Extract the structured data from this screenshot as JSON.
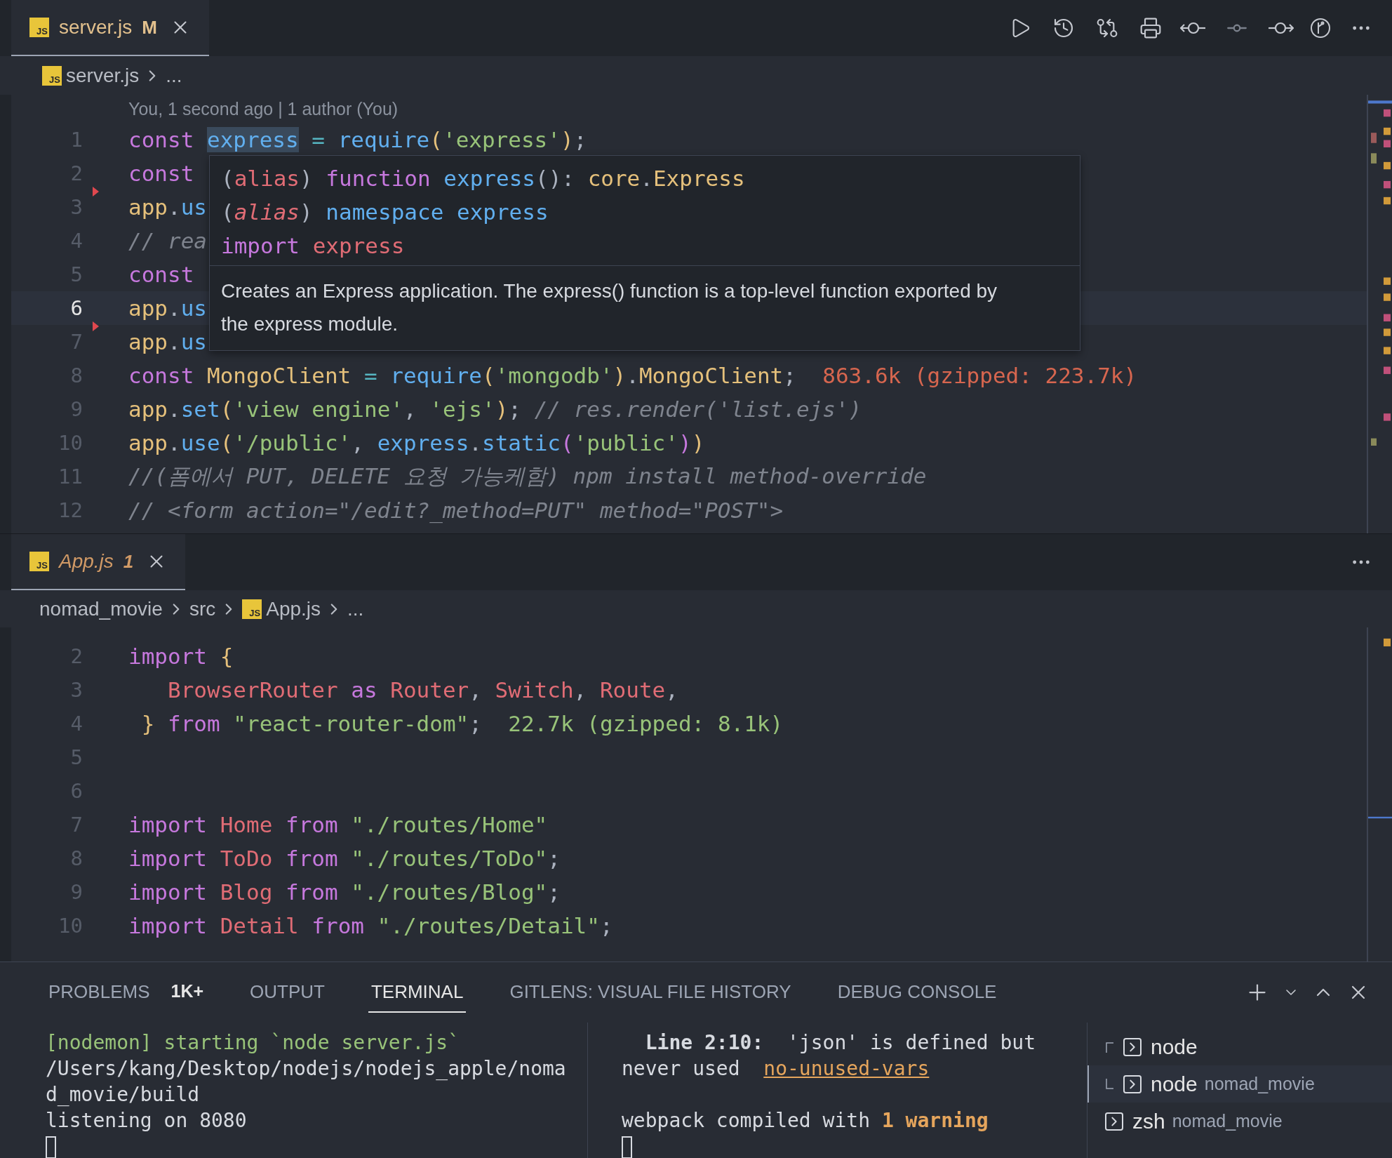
{
  "top_editor": {
    "tab": {
      "file_icon": "JS",
      "label": "server.js",
      "status": "M",
      "kind": "modified",
      "preview": false,
      "selected": true
    },
    "breadcrumbs": [
      {
        "file_icon": "JS",
        "label": "server.js"
      },
      {
        "label": "..."
      }
    ],
    "blame": "You, 1 second ago | 1 author (You)",
    "lines": [
      {
        "number": "1",
        "current": false,
        "deleted_marker": false,
        "tokens": [
          {
            "text": "const ",
            "kind": "kw"
          },
          {
            "text": "express",
            "kind": "hl"
          },
          {
            "text": " = ",
            "kind": "op"
          },
          {
            "text": "require",
            "kind": "fn"
          },
          {
            "text": "(",
            "kind": "b1"
          },
          {
            "text": "'express'",
            "kind": "str"
          },
          {
            "text": ")",
            "kind": "b1"
          },
          {
            "text": ";",
            "kind": "p"
          }
        ]
      },
      {
        "number": "2",
        "current": false,
        "deleted_marker": false,
        "tokens": [
          {
            "text": "const",
            "kind": "kw"
          }
        ]
      },
      {
        "number": "3",
        "current": false,
        "deleted_marker": true,
        "tokens": [
          {
            "text": "app",
            "kind": "cls"
          },
          {
            "text": ".",
            "kind": "p"
          },
          {
            "text": "us",
            "kind": "fn"
          }
        ]
      },
      {
        "number": "4",
        "current": false,
        "deleted_marker": false,
        "tokens": [
          {
            "text": "// rea",
            "kind": "cm"
          }
        ]
      },
      {
        "number": "5",
        "current": false,
        "deleted_marker": false,
        "tokens": [
          {
            "text": "const",
            "kind": "kw"
          }
        ]
      },
      {
        "number": "6",
        "current": true,
        "deleted_marker": false,
        "tokens": [
          {
            "text": "app",
            "kind": "cls"
          },
          {
            "text": ".",
            "kind": "p"
          },
          {
            "text": "us",
            "kind": "fn"
          }
        ]
      },
      {
        "number": "7",
        "current": false,
        "deleted_marker": true,
        "tokens": [
          {
            "text": "app",
            "kind": "cls"
          },
          {
            "text": ".",
            "kind": "p"
          },
          {
            "text": "us",
            "kind": "fn"
          }
        ]
      },
      {
        "number": "8",
        "current": false,
        "deleted_marker": false,
        "tokens": [
          {
            "text": "const ",
            "kind": "kw"
          },
          {
            "text": "MongoClient",
            "kind": "cls"
          },
          {
            "text": " = ",
            "kind": "op"
          },
          {
            "text": "require",
            "kind": "fn"
          },
          {
            "text": "(",
            "kind": "b1"
          },
          {
            "text": "'mongodb'",
            "kind": "str"
          },
          {
            "text": ")",
            "kind": "b1"
          },
          {
            "text": ".",
            "kind": "p"
          },
          {
            "text": "MongoClient",
            "kind": "cls"
          },
          {
            "text": ";",
            "kind": "p"
          },
          {
            "text": "  863.6k (gzipped: 223.7k)",
            "kind": "sizered"
          }
        ]
      },
      {
        "number": "9",
        "current": false,
        "deleted_marker": false,
        "tokens": [
          {
            "text": "app",
            "kind": "cls"
          },
          {
            "text": ".",
            "kind": "p"
          },
          {
            "text": "set",
            "kind": "fn"
          },
          {
            "text": "(",
            "kind": "b1"
          },
          {
            "text": "'view engine'",
            "kind": "str"
          },
          {
            "text": ", ",
            "kind": "p"
          },
          {
            "text": "'ejs'",
            "kind": "str"
          },
          {
            "text": ")",
            "kind": "b1"
          },
          {
            "text": ";",
            "kind": "p"
          },
          {
            "text": " // res.render('list.ejs')",
            "kind": "cm"
          }
        ]
      },
      {
        "number": "10",
        "current": false,
        "deleted_marker": false,
        "tokens": [
          {
            "text": "app",
            "kind": "cls"
          },
          {
            "text": ".",
            "kind": "p"
          },
          {
            "text": "use",
            "kind": "fn"
          },
          {
            "text": "(",
            "kind": "b1"
          },
          {
            "text": "'/public'",
            "kind": "str"
          },
          {
            "text": ", ",
            "kind": "p"
          },
          {
            "text": "express",
            "kind": "var"
          },
          {
            "text": ".",
            "kind": "p"
          },
          {
            "text": "static",
            "kind": "fn"
          },
          {
            "text": "(",
            "kind": "b2"
          },
          {
            "text": "'public'",
            "kind": "str"
          },
          {
            "text": ")",
            "kind": "b2"
          },
          {
            "text": ")",
            "kind": "b1"
          }
        ]
      },
      {
        "number": "11",
        "current": false,
        "deleted_marker": false,
        "tokens": [
          {
            "text": "//(폼에서 PUT, DELETE 요청 가능케함) npm install method-override",
            "kind": "cm"
          }
        ]
      },
      {
        "number": "12",
        "current": false,
        "deleted_marker": false,
        "tokens": [
          {
            "text": "// <form action=\"/edit?_method=PUT\" method=\"POST\">",
            "kind": "cm"
          }
        ]
      }
    ],
    "hover": {
      "signature": [
        [
          {
            "text": "(",
            "kind": "p"
          },
          {
            "text": "alias",
            "kind": "param"
          },
          {
            "text": ") ",
            "kind": "p"
          },
          {
            "text": "function ",
            "kind": "kw"
          },
          {
            "text": "express",
            "kind": "fn"
          },
          {
            "text": "(): ",
            "kind": "p"
          },
          {
            "text": "core",
            "kind": "cls"
          },
          {
            "text": ".",
            "kind": "p"
          },
          {
            "text": "Express",
            "kind": "cls"
          }
        ],
        [
          {
            "text": "(",
            "kind": "p"
          },
          {
            "text": "alias",
            "kind": "parami"
          },
          {
            "text": ") ",
            "kind": "p"
          },
          {
            "text": "namespace express",
            "kind": "fn"
          }
        ],
        [
          {
            "text": "import ",
            "kind": "kw"
          },
          {
            "text": "express",
            "kind": "id"
          }
        ]
      ],
      "description": "Creates an Express application. The express() function is a top-level function exported by the express module."
    }
  },
  "bottom_editor": {
    "tab": {
      "file_icon": "JS",
      "label": "App.js",
      "status": "1",
      "kind": "problems",
      "preview": true,
      "selected": true
    },
    "breadcrumbs": [
      {
        "label": "nomad_movie"
      },
      {
        "label": "src"
      },
      {
        "file_icon": "JS",
        "label": "App.js"
      },
      {
        "label": "..."
      }
    ],
    "lines": [
      {
        "number": "2",
        "current": false,
        "deleted_marker": false,
        "tokens": [
          {
            "text": "import ",
            "kind": "kw"
          },
          {
            "text": "{",
            "kind": "b1"
          }
        ]
      },
      {
        "number": "3",
        "current": false,
        "deleted_marker": false,
        "tokens": [
          {
            "text": "   BrowserRouter",
            "kind": "id"
          },
          {
            "text": " as ",
            "kind": "kw"
          },
          {
            "text": "Router",
            "kind": "id"
          },
          {
            "text": ", ",
            "kind": "p"
          },
          {
            "text": "Switch",
            "kind": "id"
          },
          {
            "text": ", ",
            "kind": "p"
          },
          {
            "text": "Route",
            "kind": "id"
          },
          {
            "text": ",",
            "kind": "p"
          }
        ]
      },
      {
        "number": "4",
        "current": false,
        "deleted_marker": false,
        "tokens": [
          {
            "text": " }",
            "kind": "b1"
          },
          {
            "text": " from ",
            "kind": "kw"
          },
          {
            "text": "\"react-router-dom\"",
            "kind": "str"
          },
          {
            "text": ";",
            "kind": "p"
          },
          {
            "text": "  22.7k (gzipped: 8.1k)",
            "kind": "sizegreen"
          }
        ]
      },
      {
        "number": "5",
        "current": false,
        "deleted_marker": false
      },
      {
        "number": "6",
        "current": false,
        "deleted_marker": false
      },
      {
        "number": "7",
        "current": false,
        "deleted_marker": false,
        "tokens": [
          {
            "text": "import ",
            "kind": "kw"
          },
          {
            "text": "Home",
            "kind": "id"
          },
          {
            "text": " from ",
            "kind": "kw"
          },
          {
            "text": "\"./routes/Home\"",
            "kind": "str"
          }
        ]
      },
      {
        "number": "8",
        "current": false,
        "deleted_marker": false,
        "tokens": [
          {
            "text": "import ",
            "kind": "kw"
          },
          {
            "text": "ToDo",
            "kind": "id"
          },
          {
            "text": " from ",
            "kind": "kw"
          },
          {
            "text": "\"./routes/ToDo\"",
            "kind": "str"
          },
          {
            "text": ";",
            "kind": "p"
          }
        ]
      },
      {
        "number": "9",
        "current": false,
        "deleted_marker": false,
        "tokens": [
          {
            "text": "import ",
            "kind": "kw"
          },
          {
            "text": "Blog",
            "kind": "id"
          },
          {
            "text": " from ",
            "kind": "kw"
          },
          {
            "text": "\"./routes/Blog\"",
            "kind": "str"
          },
          {
            "text": ";",
            "kind": "p"
          }
        ]
      },
      {
        "number": "10",
        "current": false,
        "deleted_marker": false,
        "tokens": [
          {
            "text": "import ",
            "kind": "kw"
          },
          {
            "text": "Detail",
            "kind": "id"
          },
          {
            "text": " from ",
            "kind": "kw"
          },
          {
            "text": "\"./routes/Detail\"",
            "kind": "str"
          },
          {
            "text": ";",
            "kind": "p"
          }
        ]
      }
    ]
  },
  "panel": {
    "tabs": [
      {
        "label": "PROBLEMS",
        "badge": "1K+",
        "selected": false
      },
      {
        "label": "OUTPUT",
        "selected": false
      },
      {
        "label": "TERMINAL",
        "selected": true
      },
      {
        "label": "GITLENS: VISUAL FILE HISTORY",
        "selected": false
      },
      {
        "label": "DEBUG CONSOLE",
        "selected": false
      }
    ],
    "terminal_left": [
      [
        {
          "text": "[nodemon] starting `node server.js`",
          "kind": "green"
        }
      ],
      [
        {
          "text": "/Users/kang/Desktop/nodejs/nodejs_apple/noma",
          "kind": "n"
        }
      ],
      [
        {
          "text": "d_movie/build",
          "kind": "n"
        }
      ],
      [
        {
          "text": "listening on 8080",
          "kind": "n"
        }
      ]
    ],
    "terminal_middle": {
      "problem": [
        [
          {
            "text": "  Line 2:10:",
            "kind": "bold"
          },
          {
            "text": "  'json' is defined but",
            "kind": "n"
          }
        ],
        [
          {
            "text": "never used  ",
            "kind": "n"
          },
          {
            "text": "no-unused-vars",
            "kind": "link"
          }
        ]
      ],
      "status": [
        [
          {
            "text": "webpack compiled with ",
            "kind": "n"
          },
          {
            "text": "1 warning",
            "kind": "warn"
          }
        ]
      ]
    },
    "terminals": [
      {
        "name": "node",
        "kind": "first-child",
        "selected": false
      },
      {
        "name": "node",
        "detail": "nomad_movie",
        "kind": "last-child",
        "selected": true
      },
      {
        "name": "zsh",
        "detail": "nomad_movie",
        "kind": "root",
        "selected": false
      }
    ]
  }
}
